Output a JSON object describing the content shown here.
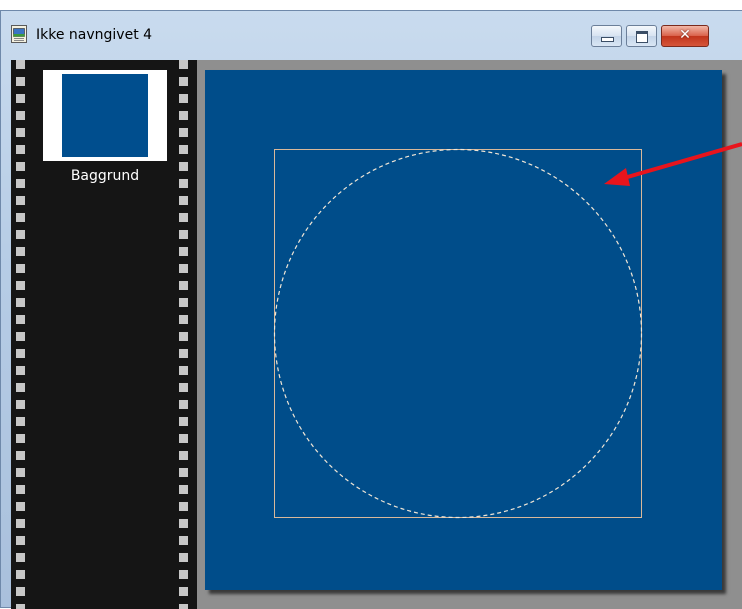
{
  "window": {
    "title": "Ikke navngivet 4",
    "buttons": {
      "minimize": "minimize-button",
      "maximize": "maximize-button",
      "close": "close-button"
    },
    "close_glyph": "✕"
  },
  "layers": [
    {
      "label": "Baggrund",
      "color": "#004e8e"
    }
  ],
  "canvas": {
    "background": "#004d8a",
    "selection_shape": "ellipse",
    "selection_stroke": "#f0e6d6",
    "bounding_box_stroke": "#d9b89a"
  },
  "annotation": {
    "type": "arrow",
    "color": "#e8141c"
  },
  "icons": {
    "app": "image-document-icon"
  }
}
